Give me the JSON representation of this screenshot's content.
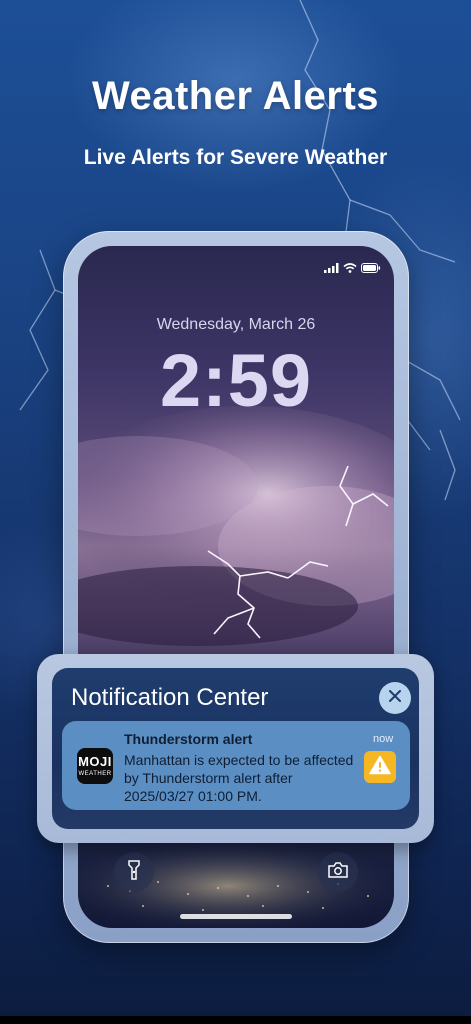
{
  "promo": {
    "headline": "Weather Alerts",
    "subheadline": "Live Alerts for Severe Weather"
  },
  "lock_screen": {
    "date": "Wednesday, March 26",
    "time": "2:59",
    "status_icons": [
      "signal-icon",
      "wifi-icon",
      "battery-icon"
    ],
    "buttons": [
      "flashlight-icon",
      "camera-icon"
    ]
  },
  "notification_center": {
    "title": "Notification Center",
    "close_icon": "close-icon",
    "notification": {
      "app_icon_text_top": "MOJI",
      "app_icon_text_bottom": "WEATHER",
      "title": "Thunderstorm alert",
      "time": "now",
      "body": "Manhattan is expected to be affected by Thunderstorm alert after 2025/03/27 01:00 PM.",
      "badge_icon": "warning-icon"
    }
  },
  "colors": {
    "background": "#1a4383",
    "phone_frame": "#a8bad8",
    "notification_card": "#5b8fc4",
    "warning_badge": "#f5b723",
    "close_button": "#b8d3ee"
  }
}
